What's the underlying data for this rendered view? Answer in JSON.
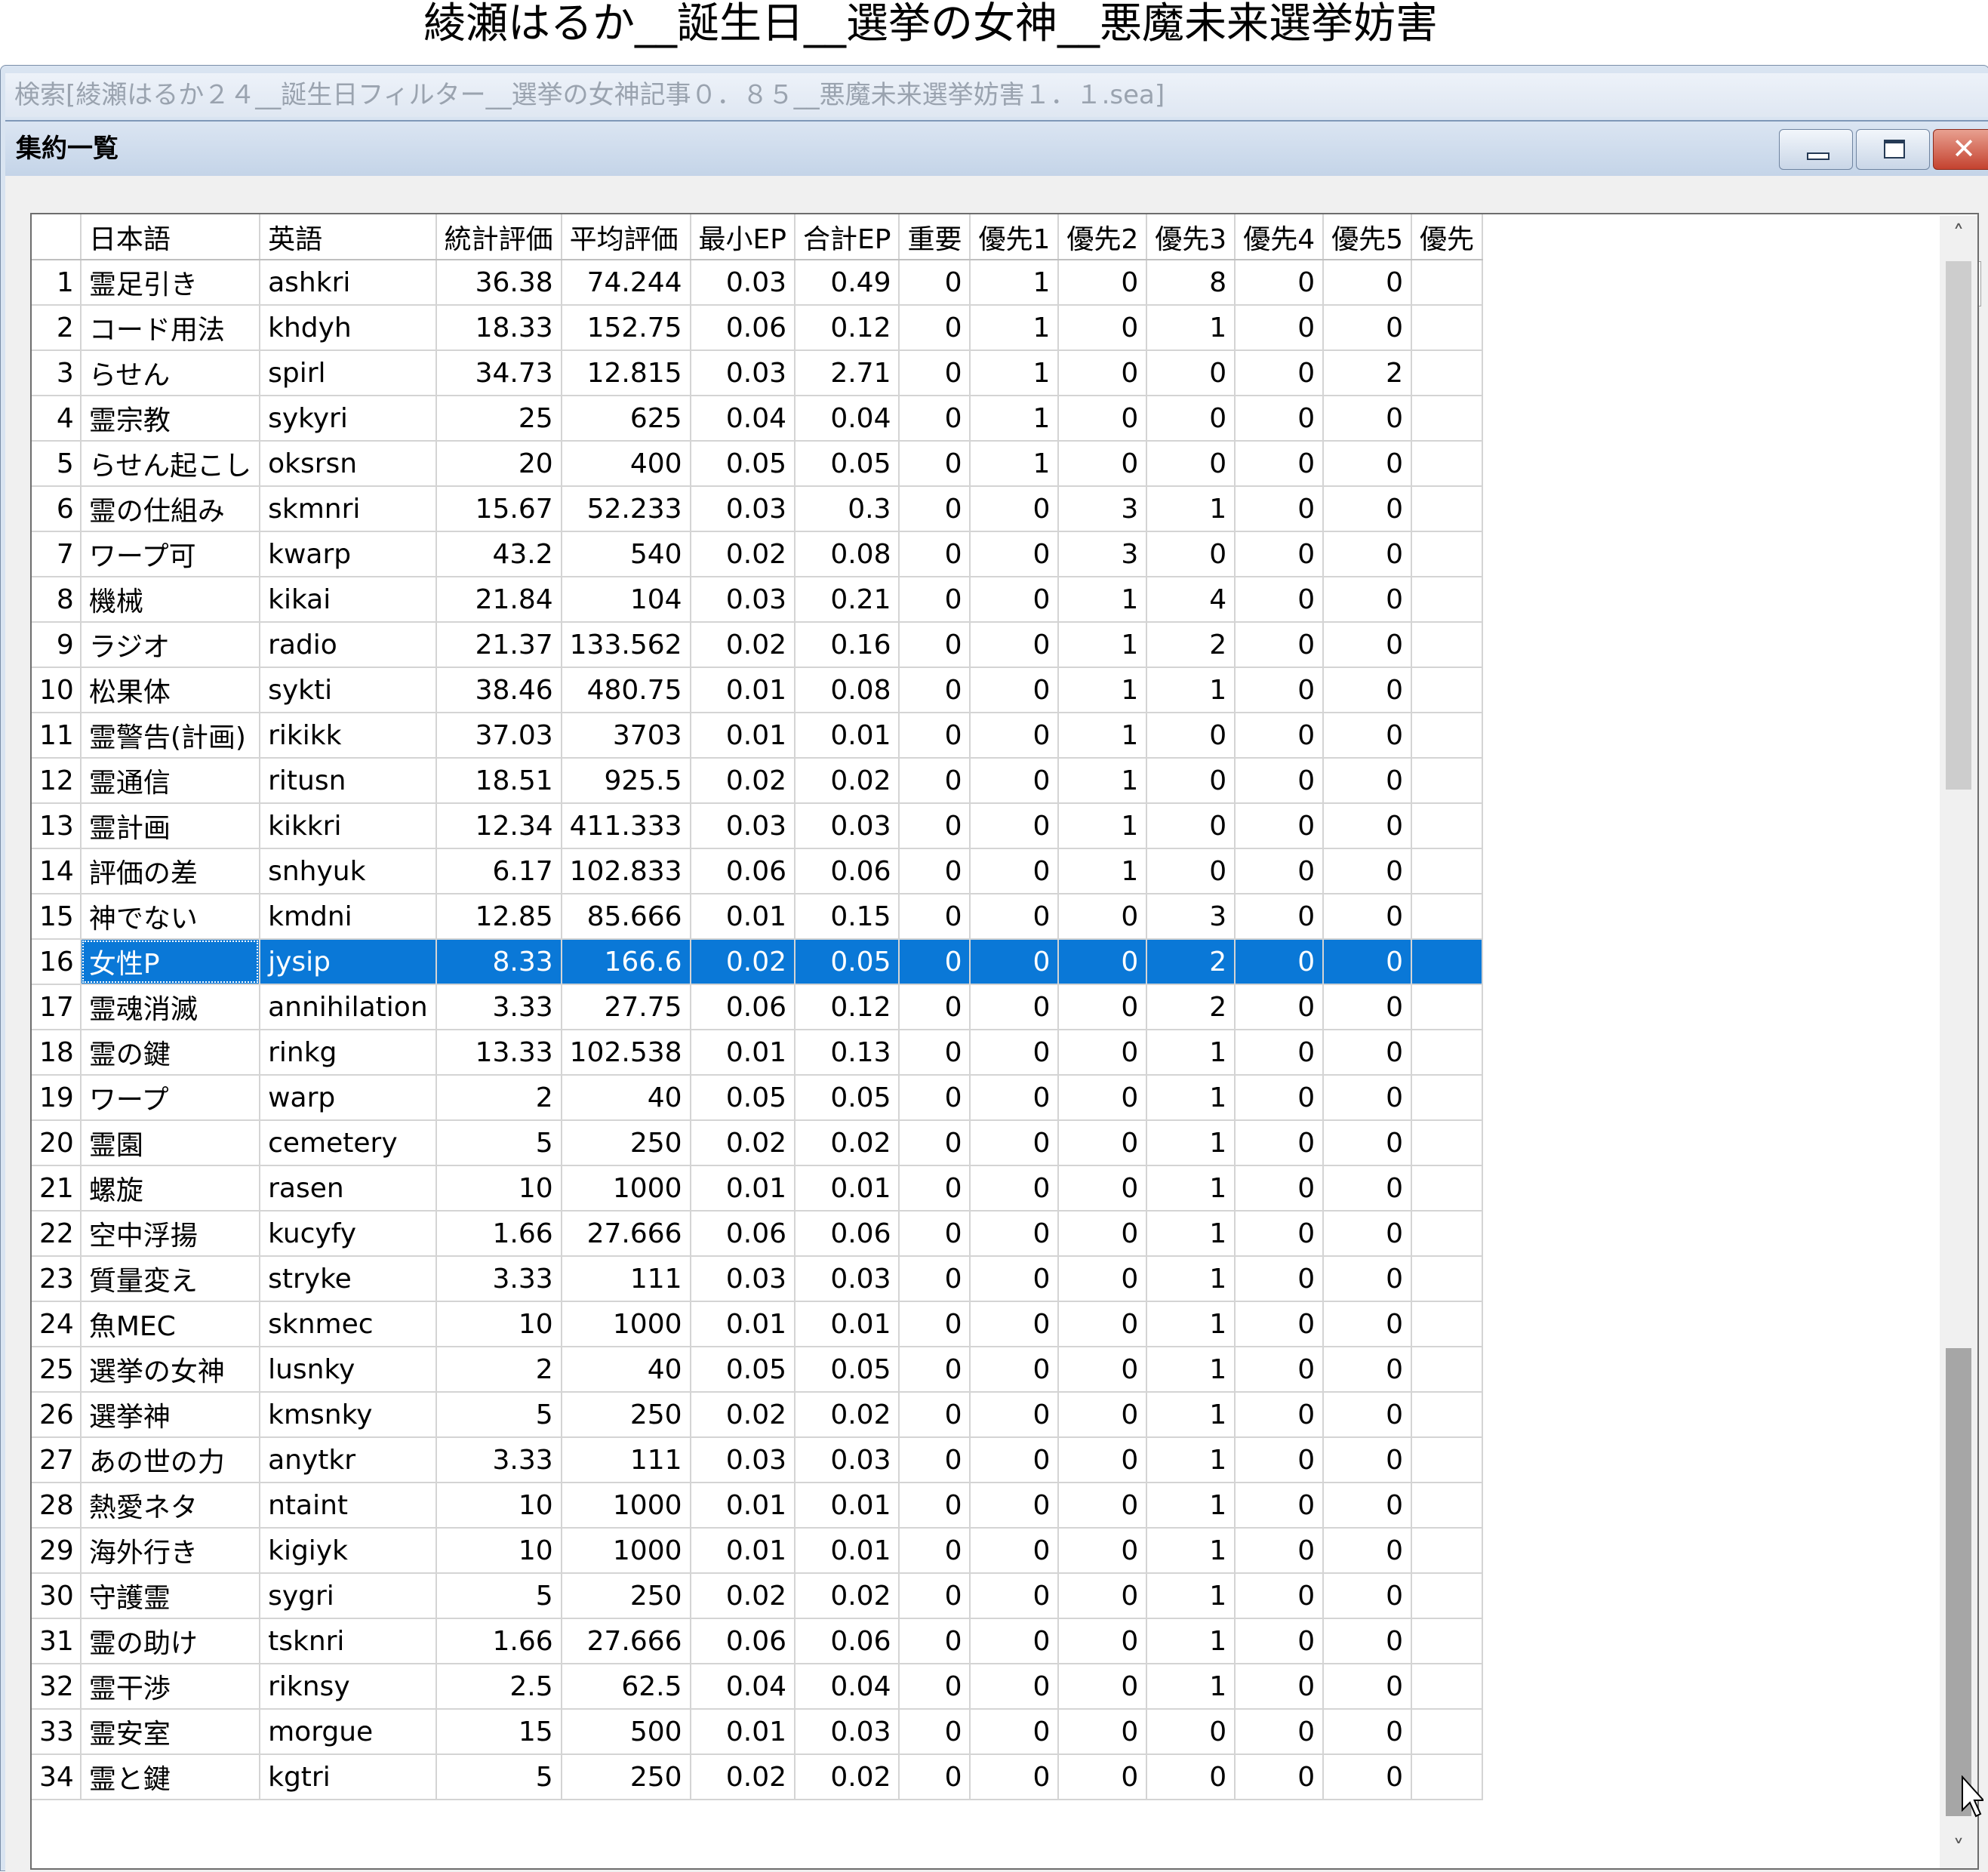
{
  "caption": "綾瀬はるか__誕生日__選挙の女神__悪魔未来選挙妨害",
  "outer_window": {
    "title": "検索[綾瀬はるか２４__誕生日フィルター__選挙の女神記事０．８５__悪魔未来選挙妨害１．１.sea]"
  },
  "inner_window": {
    "title": "集約一覧",
    "buttons": {
      "minimize": "minimize",
      "maximize": "maximize",
      "close": "✕"
    }
  },
  "count": "34",
  "grid": {
    "columns": [
      "",
      "日本語",
      "英語",
      "統計評価",
      "平均評価",
      "最小EP",
      "合計EP",
      "重要",
      "優先1",
      "優先2",
      "優先3",
      "優先4",
      "優先5",
      "優先"
    ],
    "selected_row": 16,
    "rows": [
      [
        "1",
        "霊足引き",
        "ashkri",
        "36.38",
        "74.244",
        "0.03",
        "0.49",
        "0",
        "1",
        "0",
        "8",
        "0",
        "0"
      ],
      [
        "2",
        "コード用法",
        "khdyh",
        "18.33",
        "152.75",
        "0.06",
        "0.12",
        "0",
        "1",
        "0",
        "1",
        "0",
        "0"
      ],
      [
        "3",
        "らせん",
        "spirl",
        "34.73",
        "12.815",
        "0.03",
        "2.71",
        "0",
        "1",
        "0",
        "0",
        "0",
        "2"
      ],
      [
        "4",
        "霊宗教",
        "sykyri",
        "25",
        "625",
        "0.04",
        "0.04",
        "0",
        "1",
        "0",
        "0",
        "0",
        "0"
      ],
      [
        "5",
        "らせん起こし",
        "oksrsn",
        "20",
        "400",
        "0.05",
        "0.05",
        "0",
        "1",
        "0",
        "0",
        "0",
        "0"
      ],
      [
        "6",
        "霊の仕組み",
        "skmnri",
        "15.67",
        "52.233",
        "0.03",
        "0.3",
        "0",
        "0",
        "3",
        "1",
        "0",
        "0"
      ],
      [
        "7",
        "ワープ可",
        "kwarp",
        "43.2",
        "540",
        "0.02",
        "0.08",
        "0",
        "0",
        "3",
        "0",
        "0",
        "0"
      ],
      [
        "8",
        "機械",
        "kikai",
        "21.84",
        "104",
        "0.03",
        "0.21",
        "0",
        "0",
        "1",
        "4",
        "0",
        "0"
      ],
      [
        "9",
        "ラジオ",
        "radio",
        "21.37",
        "133.562",
        "0.02",
        "0.16",
        "0",
        "0",
        "1",
        "2",
        "0",
        "0"
      ],
      [
        "10",
        "松果体",
        "sykti",
        "38.46",
        "480.75",
        "0.01",
        "0.08",
        "0",
        "0",
        "1",
        "1",
        "0",
        "0"
      ],
      [
        "11",
        "霊警告(計画)",
        "rikikk",
        "37.03",
        "3703",
        "0.01",
        "0.01",
        "0",
        "0",
        "1",
        "0",
        "0",
        "0"
      ],
      [
        "12",
        "霊通信",
        "ritusn",
        "18.51",
        "925.5",
        "0.02",
        "0.02",
        "0",
        "0",
        "1",
        "0",
        "0",
        "0"
      ],
      [
        "13",
        "霊計画",
        "kikkri",
        "12.34",
        "411.333",
        "0.03",
        "0.03",
        "0",
        "0",
        "1",
        "0",
        "0",
        "0"
      ],
      [
        "14",
        "評価の差",
        "snhyuk",
        "6.17",
        "102.833",
        "0.06",
        "0.06",
        "0",
        "0",
        "1",
        "0",
        "0",
        "0"
      ],
      [
        "15",
        "神でない",
        "kmdni",
        "12.85",
        "85.666",
        "0.01",
        "0.15",
        "0",
        "0",
        "0",
        "3",
        "0",
        "0"
      ],
      [
        "16",
        "女性P",
        "jysip",
        "8.33",
        "166.6",
        "0.02",
        "0.05",
        "0",
        "0",
        "0",
        "2",
        "0",
        "0"
      ],
      [
        "17",
        "霊魂消滅",
        "annihilation",
        "3.33",
        "27.75",
        "0.06",
        "0.12",
        "0",
        "0",
        "0",
        "2",
        "0",
        "0"
      ],
      [
        "18",
        "霊の鍵",
        "rinkg",
        "13.33",
        "102.538",
        "0.01",
        "0.13",
        "0",
        "0",
        "0",
        "1",
        "0",
        "0"
      ],
      [
        "19",
        "ワープ",
        "warp",
        "2",
        "40",
        "0.05",
        "0.05",
        "0",
        "0",
        "0",
        "1",
        "0",
        "0"
      ],
      [
        "20",
        "霊園",
        "cemetery",
        "5",
        "250",
        "0.02",
        "0.02",
        "0",
        "0",
        "0",
        "1",
        "0",
        "0"
      ],
      [
        "21",
        "螺旋",
        "rasen",
        "10",
        "1000",
        "0.01",
        "0.01",
        "0",
        "0",
        "0",
        "1",
        "0",
        "0"
      ],
      [
        "22",
        "空中浮揚",
        "kucyfy",
        "1.66",
        "27.666",
        "0.06",
        "0.06",
        "0",
        "0",
        "0",
        "1",
        "0",
        "0"
      ],
      [
        "23",
        "質量変え",
        "stryke",
        "3.33",
        "111",
        "0.03",
        "0.03",
        "0",
        "0",
        "0",
        "1",
        "0",
        "0"
      ],
      [
        "24",
        "魚MEC",
        "sknmec",
        "10",
        "1000",
        "0.01",
        "0.01",
        "0",
        "0",
        "0",
        "1",
        "0",
        "0"
      ],
      [
        "25",
        "選挙の女神",
        "lusnky",
        "2",
        "40",
        "0.05",
        "0.05",
        "0",
        "0",
        "0",
        "1",
        "0",
        "0"
      ],
      [
        "26",
        "選挙神",
        "kmsnky",
        "5",
        "250",
        "0.02",
        "0.02",
        "0",
        "0",
        "0",
        "1",
        "0",
        "0"
      ],
      [
        "27",
        "あの世の力",
        "anytkr",
        "3.33",
        "111",
        "0.03",
        "0.03",
        "0",
        "0",
        "0",
        "1",
        "0",
        "0"
      ],
      [
        "28",
        "熱愛ネタ",
        "ntaint",
        "10",
        "1000",
        "0.01",
        "0.01",
        "0",
        "0",
        "0",
        "1",
        "0",
        "0"
      ],
      [
        "29",
        "海外行き",
        "kigiyk",
        "10",
        "1000",
        "0.01",
        "0.01",
        "0",
        "0",
        "0",
        "1",
        "0",
        "0"
      ],
      [
        "30",
        "守護霊",
        "sygri",
        "5",
        "250",
        "0.02",
        "0.02",
        "0",
        "0",
        "0",
        "1",
        "0",
        "0"
      ],
      [
        "31",
        "霊の助け",
        "tsknri",
        "1.66",
        "27.666",
        "0.06",
        "0.06",
        "0",
        "0",
        "0",
        "1",
        "0",
        "0"
      ],
      [
        "32",
        "霊干渉",
        "riknsy",
        "2.5",
        "62.5",
        "0.04",
        "0.04",
        "0",
        "0",
        "0",
        "1",
        "0",
        "0"
      ],
      [
        "33",
        "霊安室",
        "morgue",
        "15",
        "500",
        "0.01",
        "0.03",
        "0",
        "0",
        "0",
        "0",
        "0",
        "0"
      ],
      [
        "34",
        "霊と鍵",
        "kgtri",
        "5",
        "250",
        "0.02",
        "0.02",
        "0",
        "0",
        "0",
        "0",
        "0",
        "0"
      ]
    ]
  },
  "scrollbar": {
    "up_icon": "chevron-up-icon",
    "down_icon": "chevron-down-icon"
  },
  "colors": {
    "selection": "#0a78d7",
    "titlebar": "#c4d4e8"
  }
}
